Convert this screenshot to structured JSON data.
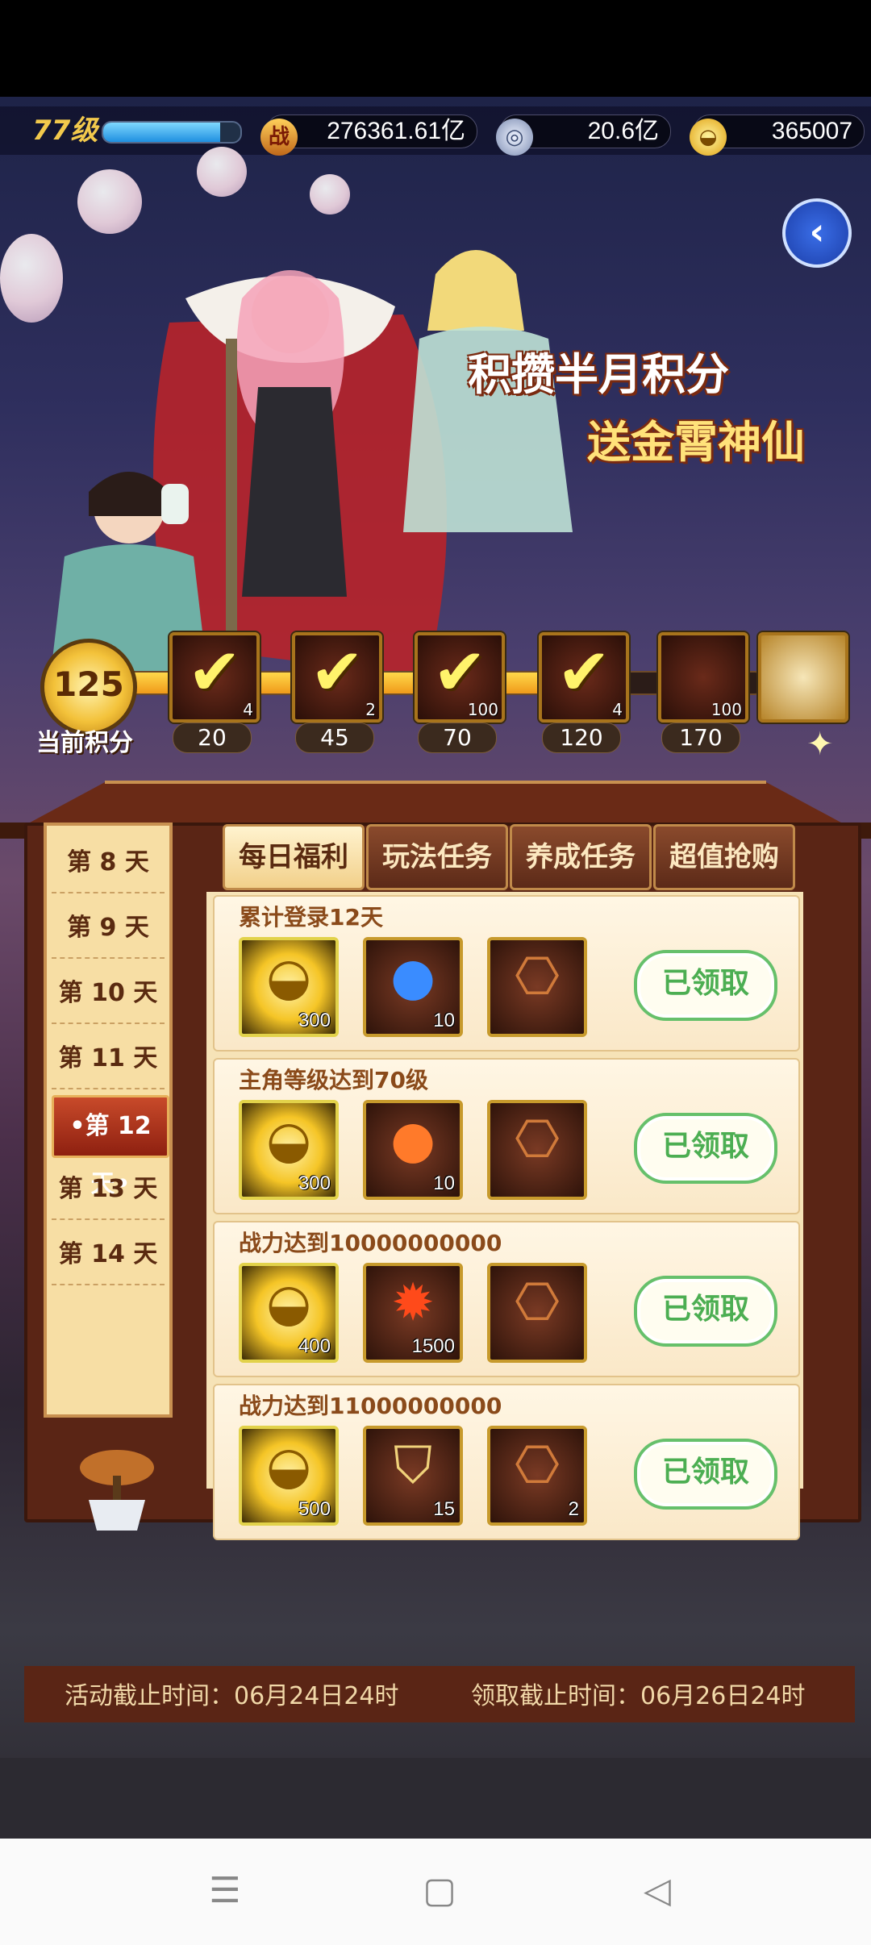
{
  "header": {
    "level": "77级",
    "xp_fraction": 0.85,
    "power_icon": "战",
    "power": "276361.61亿",
    "silver": "20.6亿",
    "gold": "365007"
  },
  "banner": {
    "line1": "积攒半月积分",
    "line2": "送金霄神仙"
  },
  "progress": {
    "current_score": "125",
    "current_label": "当前积分",
    "fill_fraction": 0.77,
    "milestones": [
      {
        "threshold": "20",
        "count": "4",
        "claimed": true
      },
      {
        "threshold": "45",
        "count": "2",
        "claimed": true
      },
      {
        "threshold": "70",
        "count": "100",
        "claimed": true
      },
      {
        "threshold": "120",
        "count": "4",
        "claimed": true
      },
      {
        "threshold": "170",
        "count": "100",
        "claimed": false
      }
    ]
  },
  "days": {
    "items": [
      "第 8 天",
      "第 9 天",
      "第 10 天",
      "第 11 天",
      "•第 12 天•",
      "第 13 天",
      "第 14 天"
    ],
    "active_index": 4
  },
  "tabs": [
    "每日福利",
    "玩法任务",
    "养成任务",
    "超值抢购"
  ],
  "tasks": [
    {
      "title": "累计登录12天",
      "rewards": [
        {
          "icon": "gold-ingot-icon",
          "count": "300"
        },
        {
          "icon": "blue-orb-icon",
          "count": "10"
        },
        {
          "icon": "ticket-icon",
          "count": ""
        }
      ],
      "button": "已领取"
    },
    {
      "title": "主角等级达到70级",
      "rewards": [
        {
          "icon": "gold-ingot-icon",
          "count": "300"
        },
        {
          "icon": "orange-orb-icon",
          "count": "10"
        },
        {
          "icon": "ticket-icon",
          "count": ""
        }
      ],
      "button": "已领取"
    },
    {
      "title": "战力达到10000000000",
      "rewards": [
        {
          "icon": "gold-ingot-icon",
          "count": "400"
        },
        {
          "icon": "fire-orb-icon",
          "count": "1500"
        },
        {
          "icon": "ticket-icon",
          "count": ""
        }
      ],
      "button": "已领取"
    },
    {
      "title": "战力达到11000000000",
      "rewards": [
        {
          "icon": "gold-ingot-icon",
          "count": "500"
        },
        {
          "icon": "shield-crest-icon",
          "count": "15"
        },
        {
          "icon": "ticket-icon",
          "count": "2"
        }
      ],
      "button": "已领取"
    }
  ],
  "footer": {
    "activity_end": "活动截止时间：06月24日24时",
    "claim_end": "领取截止时间：06月26日24时"
  },
  "colors": {
    "claim_green": "#4cae52",
    "panel_brown": "#5a2515",
    "gold": "#f3c23a"
  }
}
